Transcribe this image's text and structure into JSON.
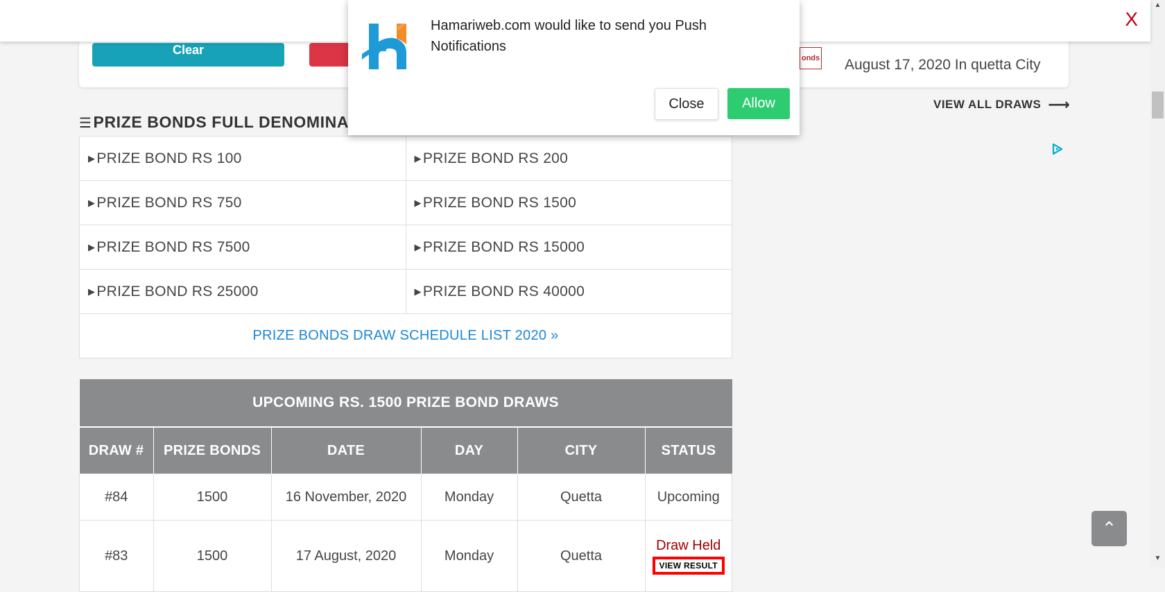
{
  "notify_strip": {
    "close_label": "X"
  },
  "result_card": {
    "clear_button_label": "Clear",
    "bonds_thumb_text": "onds",
    "draw_info": "August 17, 2020 In quetta City"
  },
  "view_all_draws": "VIEW ALL DRAWS",
  "view_all_arrow": "⟶",
  "denominations": {
    "title": "PRIZE BONDS FULL DENOMINA",
    "list_icon": "☰",
    "items": [
      "PRIZE BOND RS 100",
      "PRIZE BOND RS 200",
      "PRIZE BOND RS 750",
      "PRIZE BOND RS 1500",
      "PRIZE BOND RS 7500",
      "PRIZE BOND RS 15000",
      "PRIZE BOND RS 25000",
      "PRIZE BOND RS 40000"
    ],
    "schedule_link": "PRIZE BONDS DRAW SCHEDULE LIST 2020 »"
  },
  "upcoming": {
    "title": "UPCOMING RS. 1500 PRIZE BOND DRAWS",
    "columns": [
      "DRAW #",
      "PRIZE BONDS",
      "DATE",
      "DAY",
      "CITY",
      "STATUS"
    ],
    "rows": [
      {
        "draw": "#84",
        "bonds": "1500",
        "date": "16 November, 2020",
        "day": "Monday",
        "city": "Quetta",
        "status": "Upcoming"
      },
      {
        "draw": "#83",
        "bonds": "1500",
        "date": "17 August, 2020",
        "day": "Monday",
        "city": "Quetta",
        "status": "Draw Held",
        "action": "VIEW RESULT"
      }
    ]
  },
  "push": {
    "message": "Hamariweb.com would like to send you Push Notifications",
    "close_label": "Close",
    "allow_label": "Allow",
    "logo_colors": {
      "blue": "#1e9ad6",
      "orange": "#f28c28"
    }
  },
  "scroll_top_icon": "⌃",
  "colors": {
    "teal": "#17a2b8",
    "red": "#dc3545",
    "table_header": "#8a8b8d",
    "link_blue": "#1a87d6",
    "upcoming_green": "#1a8a1a",
    "held_red": "#a10000",
    "allow_green": "#2ecc71"
  }
}
